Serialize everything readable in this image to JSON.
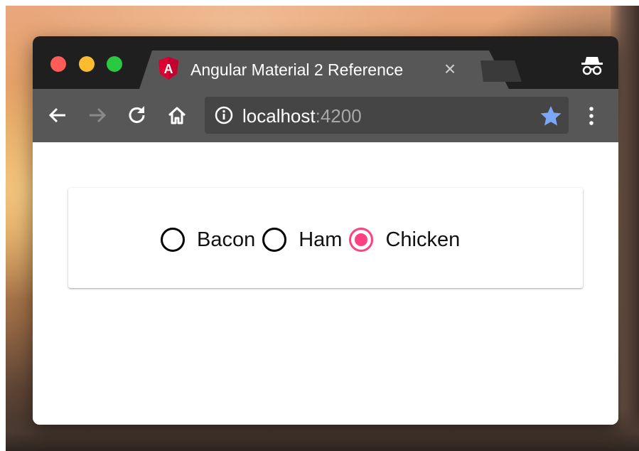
{
  "browser": {
    "tab": {
      "title": "Angular Material 2 Reference",
      "close_label": "×",
      "favicon": "angular-logo-icon",
      "favicon_letter": "A"
    },
    "address_bar": {
      "host": "localhost",
      "port": ":4200"
    },
    "icons": {
      "back": "back-arrow-icon",
      "forward": "forward-arrow-icon",
      "reload": "reload-icon",
      "home": "home-icon",
      "site_info": "info-icon",
      "bookmark": "star-icon",
      "menu": "more-vertical-icon",
      "incognito": "incognito-icon"
    }
  },
  "radio_group": {
    "options": [
      {
        "label": "Bacon",
        "checked": false
      },
      {
        "label": "Ham",
        "checked": false
      },
      {
        "label": "Chicken",
        "checked": true
      }
    ]
  },
  "colors": {
    "accent": "#ff4081",
    "star": "#7aa7f7",
    "traffic_close": "#fd5d56",
    "traffic_minimize": "#fdbb2f",
    "traffic_maximize": "#29c941"
  }
}
